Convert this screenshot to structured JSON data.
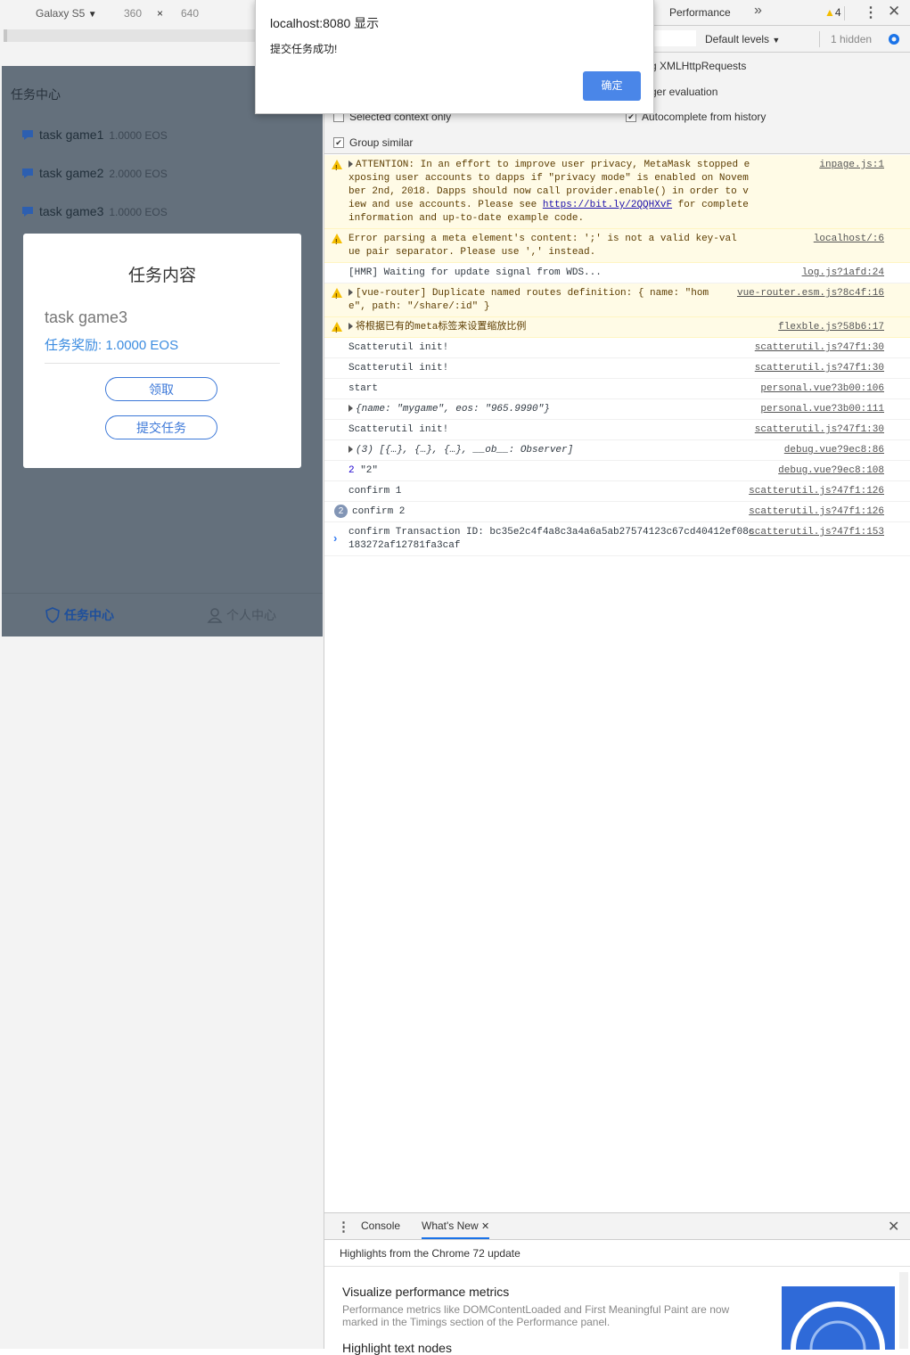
{
  "device_toolbar": {
    "device": "Galaxy S5",
    "width": "360",
    "times": "×",
    "height": "640"
  },
  "app": {
    "title": "任务中心",
    "tasks": [
      {
        "name": "task game1",
        "reward": "1.0000 EOS"
      },
      {
        "name": "task game2",
        "reward": "2.0000 EOS"
      },
      {
        "name": "task game3",
        "reward": "1.0000 EOS"
      }
    ],
    "modal": {
      "title": "任务内容",
      "task_name": "task game3",
      "reward_label": "任务奖励:",
      "reward_value": "1.0000 EOS",
      "claim_button": "领取",
      "submit_button": "提交任务"
    },
    "tabs": [
      {
        "label": "任务中心",
        "active": true
      },
      {
        "label": "个人中心",
        "active": false
      }
    ]
  },
  "alert": {
    "title": "localhost:8080 显示",
    "message": "提交任务成功!",
    "ok": "确定"
  },
  "devtools": {
    "panel_tab": "Performance",
    "more_tabs": "»",
    "warning_count": "4",
    "levels": "Default levels",
    "hidden": "1 hidden",
    "settings": {
      "log_xhr": "g XMLHttpRequests",
      "eager_eval": "ger evaluation",
      "selected_context": "Selected context only",
      "autocomplete": "Autocomplete from history",
      "group_similar": "Group similar"
    },
    "console": [
      {
        "type": "warn",
        "expand": true,
        "text": "ATTENTION: In an effort to improve user privacy, MetaMask stopped exposing user accounts to dapps if \"privacy mode\" is enabled on November 2nd, 2018. Dapps should now call provider.enable() in order to view and use accounts. Please see ",
        "link": "https://bit.ly/2QQHXvF",
        "text2": " for complete information and up-to-date example code.",
        "src": "inpage.js:1"
      },
      {
        "type": "warn",
        "text": "Error parsing a meta element's content: ';' is not a valid key-value pair separator. Please use ',' instead.",
        "src": "localhost/:6"
      },
      {
        "type": "log",
        "text": "[HMR] Waiting for update signal from WDS...",
        "src": "log.js?1afd:24"
      },
      {
        "type": "warn",
        "expand": true,
        "text": "[vue-router] Duplicate named routes definition: { name: \"home\", path: \"/share/:id\" }",
        "src": "vue-router.esm.js?8c4f:16"
      },
      {
        "type": "warn",
        "expand": true,
        "text": "将根据已有的meta标签来设置缩放比例",
        "src": "flexble.js?58b6:17"
      },
      {
        "type": "log",
        "text": "Scatterutil init!",
        "src": "scatterutil.js?47f1:30"
      },
      {
        "type": "log",
        "text": "Scatterutil init!",
        "src": "scatterutil.js?47f1:30"
      },
      {
        "type": "log",
        "text": "start",
        "src": "personal.vue?3b00:106"
      },
      {
        "type": "obj",
        "expand": true,
        "text": "{name: \"mygame\", eos: \"965.9990\"}",
        "src": "personal.vue?3b00:111"
      },
      {
        "type": "log",
        "text": "Scatterutil init!",
        "src": "scatterutil.js?47f1:30"
      },
      {
        "type": "obj",
        "expand": true,
        "text": "(3) [{…}, {…}, {…}, __ob__: Observer]",
        "src": "debug.vue?9ec8:86"
      },
      {
        "type": "log",
        "num": "2",
        "text": " \"2\"",
        "src": "debug.vue?9ec8:108"
      },
      {
        "type": "log",
        "text": "confirm 1",
        "src": "scatterutil.js?47f1:126"
      },
      {
        "type": "log",
        "badge": "2",
        "text": "confirm 2",
        "src": "scatterutil.js?47f1:126"
      },
      {
        "type": "log",
        "text": "confirm Transaction ID: bc35e2c4f4a8c3a4a6a5ab27574123c67cd40412ef08c183272af12781fa3caf",
        "src": "scatterutil.js?47f1:153"
      }
    ],
    "prompt": "›",
    "drawer": {
      "tabs": [
        "Console",
        "What's New"
      ],
      "active": "What's New",
      "subtitle": "Highlights from the Chrome 72 update",
      "item_title": "Visualize performance metrics",
      "item_desc": "Performance metrics like DOMContentLoaded and First Meaningful Paint are now marked in the Timings section of the Performance panel.",
      "next_title": "Highlight text nodes"
    }
  }
}
